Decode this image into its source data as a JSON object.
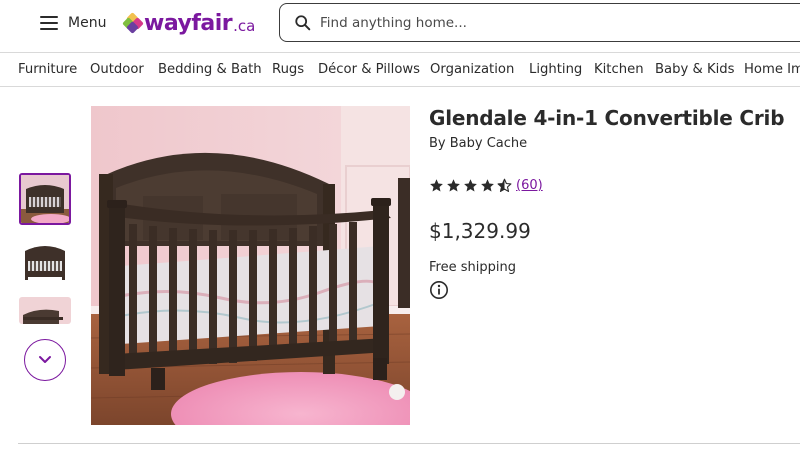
{
  "header": {
    "menu_label": "Menu",
    "logo_text": "wayfair",
    "logo_tld": ".ca",
    "search_placeholder": "Find anything home..."
  },
  "categories": [
    "Furniture",
    "Outdoor",
    "Bedding & Bath",
    "Rugs",
    "Décor & Pillows",
    "Organization",
    "Lighting",
    "Kitchen",
    "Baby & Kids",
    "Home Im"
  ],
  "gallery": {
    "thumbnails": [
      "crib-pink-room",
      "crib-white-background",
      "crib-detail"
    ],
    "active_index": 0
  },
  "product": {
    "title": "Glendale 4-in-1 Convertible Crib",
    "brand": "By Baby Cache",
    "rating": 4.5,
    "review_count": "(60)",
    "price": "$1,329.99",
    "shipping": "Free shipping"
  },
  "colors": {
    "brand_purple": "#7b189f",
    "text": "#2b2b2b",
    "divider": "#d9d9d9"
  }
}
